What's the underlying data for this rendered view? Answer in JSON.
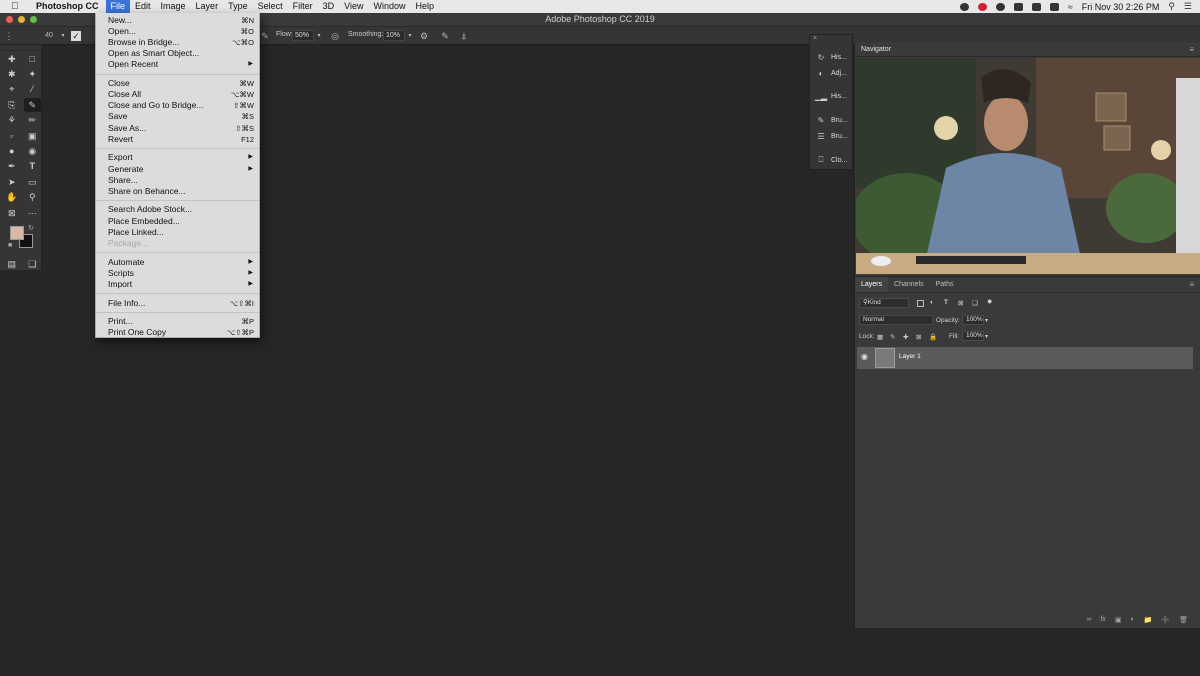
{
  "menubar": {
    "app_name": "Photoshop CC",
    "items": [
      "File",
      "Edit",
      "Image",
      "Layer",
      "Type",
      "Select",
      "Filter",
      "3D",
      "View",
      "Window",
      "Help"
    ],
    "clock": "Fri Nov 30  2:26 PM"
  },
  "window": {
    "title": "Adobe Photoshop CC 2019"
  },
  "options": {
    "brush_size": "40",
    "flow_label": "Flow:",
    "flow_value": "50%",
    "smoothing_label": "Smoothing:",
    "smoothing_value": "10%"
  },
  "file_menu": {
    "groups": [
      [
        {
          "label": "New...",
          "shortcut": "⌘N"
        },
        {
          "label": "Open...",
          "shortcut": "⌘O"
        },
        {
          "label": "Browse in Bridge...",
          "shortcut": "⌥⌘O"
        },
        {
          "label": "Open as Smart Object..."
        },
        {
          "label": "Open Recent",
          "submenu": true
        }
      ],
      [
        {
          "label": "Close",
          "shortcut": "⌘W"
        },
        {
          "label": "Close All",
          "shortcut": "⌥⌘W"
        },
        {
          "label": "Close and Go to Bridge...",
          "shortcut": "⇧⌘W"
        },
        {
          "label": "Save",
          "shortcut": "⌘S"
        },
        {
          "label": "Save As...",
          "shortcut": "⇧⌘S"
        },
        {
          "label": "Revert",
          "shortcut": "F12"
        }
      ],
      [
        {
          "label": "Export",
          "submenu": true
        },
        {
          "label": "Generate",
          "submenu": true
        },
        {
          "label": "Share..."
        },
        {
          "label": "Share on Behance..."
        }
      ],
      [
        {
          "label": "Search Adobe Stock..."
        },
        {
          "label": "Place Embedded..."
        },
        {
          "label": "Place Linked..."
        },
        {
          "label": "Package...",
          "disabled": true
        }
      ],
      [
        {
          "label": "Automate",
          "submenu": true
        },
        {
          "label": "Scripts",
          "submenu": true
        },
        {
          "label": "Import",
          "submenu": true
        }
      ],
      [
        {
          "label": "File Info...",
          "shortcut": "⌥⇧⌘I"
        }
      ],
      [
        {
          "label": "Print...",
          "shortcut": "⌘P"
        },
        {
          "label": "Print One Copy",
          "shortcut": "⌥⇧⌘P"
        }
      ]
    ]
  },
  "dock": {
    "items": [
      "His...",
      "Adj...",
      "His...",
      "Bru...",
      "Bru...",
      "Clo..."
    ]
  },
  "navigator": {
    "title": "Navigator"
  },
  "layers": {
    "tabs": [
      "Layers",
      "Channels",
      "Paths"
    ],
    "filter_kind": "Kind",
    "blend_mode": "Normal",
    "opacity_label": "Opacity:",
    "opacity_value": "100%",
    "lock_label": "Lock:",
    "fill_label": "Fill:",
    "fill_value": "100%",
    "layer_name": "Layer 1"
  },
  "colors": {
    "accent": "#3b73d9",
    "foreground_swatch": "#d9b8a6",
    "background_swatch": "#111111"
  }
}
